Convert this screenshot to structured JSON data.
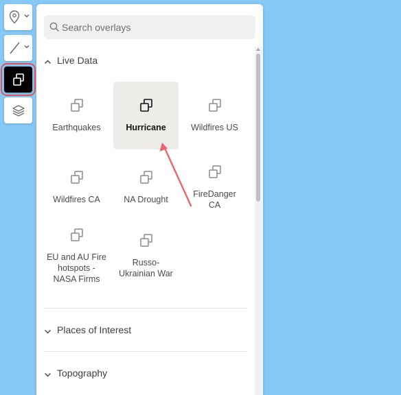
{
  "toolbar": {
    "tools": [
      {
        "name": "pin-tool",
        "icon": "map-pin-icon",
        "has_dropdown": true
      },
      {
        "name": "line-tool",
        "icon": "line-icon",
        "has_dropdown": true
      },
      {
        "name": "overlays-tool",
        "icon": "overlay-icon",
        "active": true
      },
      {
        "name": "layers-tool",
        "icon": "layers-icon"
      }
    ]
  },
  "search": {
    "placeholder": "Search overlays",
    "value": ""
  },
  "sections": {
    "live_data": {
      "title": "Live Data",
      "expanded": true,
      "items": [
        {
          "label": "Earthquakes"
        },
        {
          "label": "Hurricane",
          "selected": true
        },
        {
          "label": "Wildfires US"
        },
        {
          "label": "Wildfires CA"
        },
        {
          "label": "NA Drought"
        },
        {
          "label": "FireDanger CA"
        },
        {
          "label": "EU and AU Fire hotspots - NASA Firms"
        },
        {
          "label": "Russo-Ukrainian War"
        }
      ]
    },
    "places_of_interest": {
      "title": "Places of Interest",
      "expanded": false
    },
    "topography": {
      "title": "Topography",
      "expanded": false
    }
  },
  "colors": {
    "map_background": "#86c8f6",
    "highlight_outline": "#e0555c",
    "annotation_arrow": "#e9656b",
    "selected_item_bg": "#eeece9"
  }
}
